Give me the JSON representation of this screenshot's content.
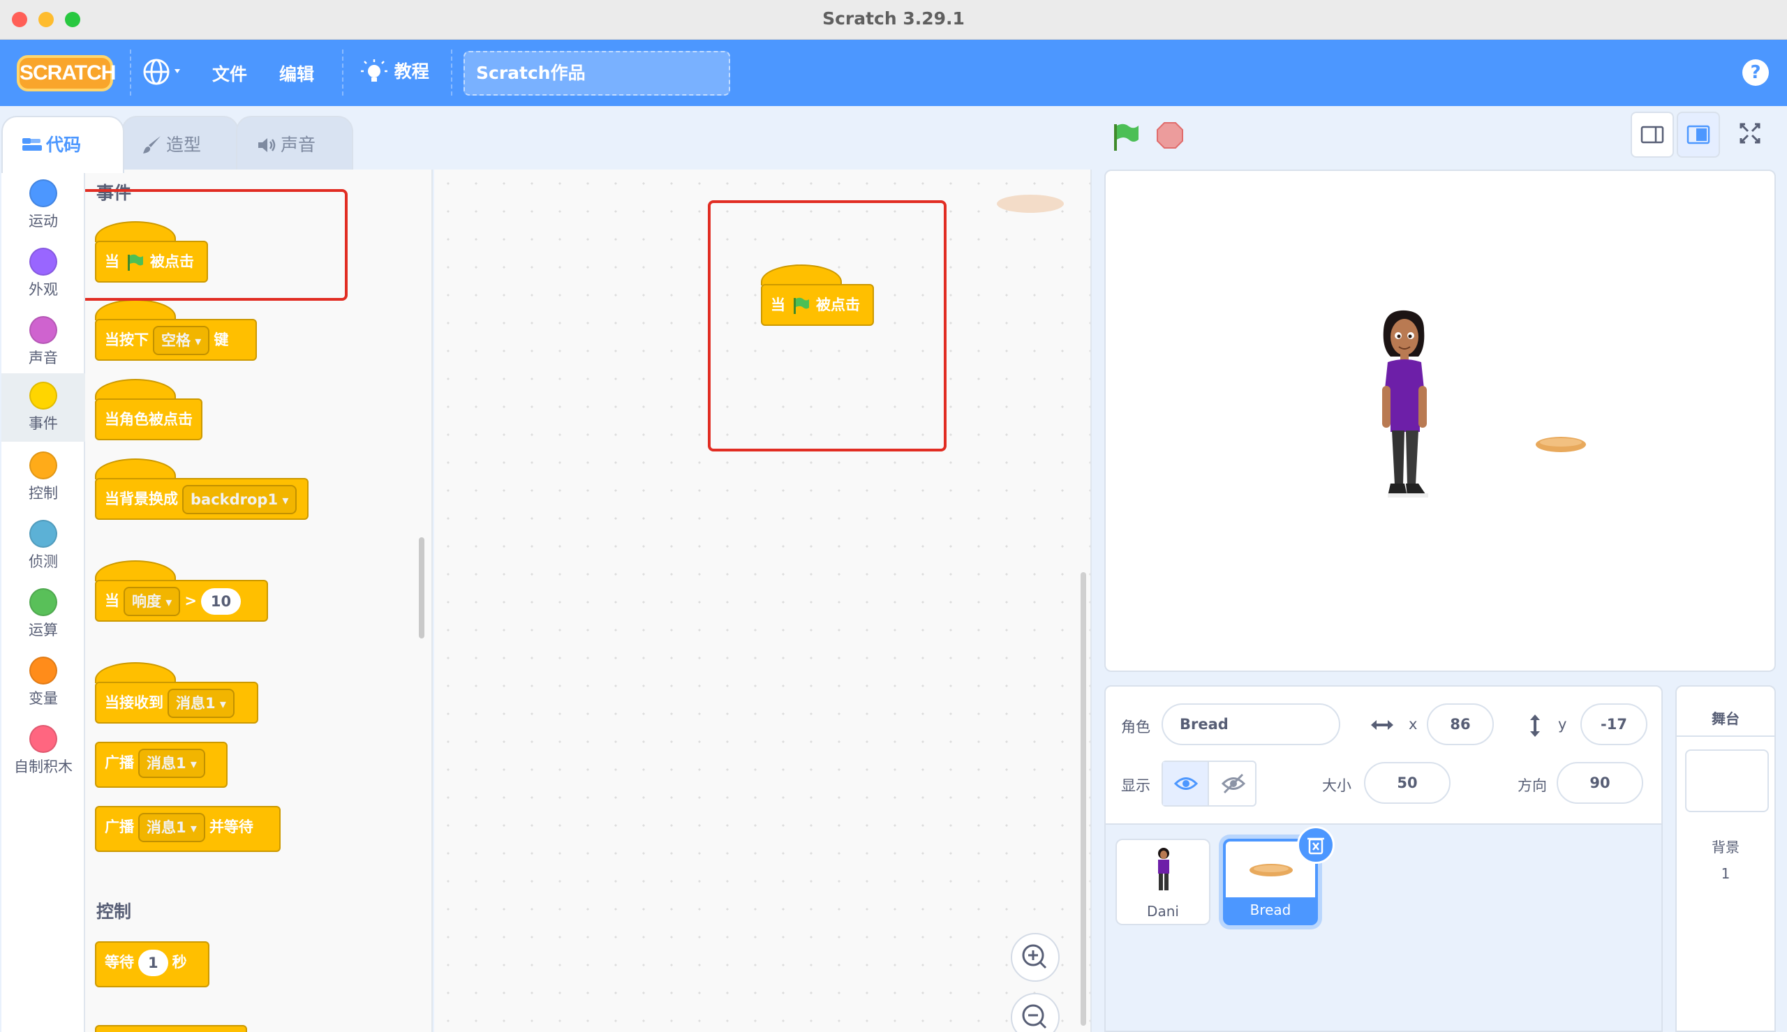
{
  "window": {
    "title": "Scratch 3.29.1"
  },
  "menu": {
    "logo": "SCRATCH",
    "file": "文件",
    "edit": "编辑",
    "tutorials": "教程",
    "project_title": "Scratch作品",
    "help": "?"
  },
  "tabs": {
    "code": "代码",
    "costumes": "造型",
    "sounds": "声音"
  },
  "categories": [
    {
      "label": "运动",
      "color": "#4c97ff"
    },
    {
      "label": "外观",
      "color": "#9966ff"
    },
    {
      "label": "声音",
      "color": "#cf63cf"
    },
    {
      "label": "事件",
      "color": "#ffd500"
    },
    {
      "label": "控制",
      "color": "#ffab19"
    },
    {
      "label": "侦测",
      "color": "#5cb1d6"
    },
    {
      "label": "运算",
      "color": "#59c059"
    },
    {
      "label": "变量",
      "color": "#ff8c1a"
    },
    {
      "label": "自制积木",
      "color": "#ff6680"
    }
  ],
  "palette": {
    "events_heading": "事件",
    "when_flag": {
      "pre": "当",
      "post": "被点击"
    },
    "when_key": {
      "pre": "当按下",
      "key": "空格",
      "post": "键"
    },
    "when_sprite_clicked": "当角色被点击",
    "when_backdrop": {
      "pre": "当背景换成",
      "value": "backdrop1"
    },
    "when_greater": {
      "pre": "当",
      "menu": "响度",
      "op": ">",
      "value": "10"
    },
    "when_receive": {
      "pre": "当接收到",
      "value": "消息1"
    },
    "broadcast": {
      "pre": "广播",
      "value": "消息1"
    },
    "broadcast_wait": {
      "pre": "广播",
      "value": "消息1",
      "post": "并等待"
    },
    "control_heading": "控制",
    "wait": {
      "pre": "等待",
      "value": "1",
      "post": "秒"
    }
  },
  "workspace": {
    "script": {
      "pre": "当",
      "post": "被点击"
    }
  },
  "sprite_info": {
    "sprite_label": "角色",
    "sprite_name": "Bread",
    "x_label": "x",
    "x": "86",
    "y_label": "y",
    "y": "-17",
    "show_label": "显示",
    "size_label": "大小",
    "size": "50",
    "direction_label": "方向",
    "direction": "90"
  },
  "sprites": [
    {
      "name": "Dani"
    },
    {
      "name": "Bread"
    }
  ],
  "stage_pane": {
    "title": "舞台",
    "backdrop_label": "背景",
    "backdrop_count": "1"
  },
  "colors": {
    "menu_blue": "#4c97ff",
    "event_yellow": "#ffbf00",
    "highlight_red": "#e12d23"
  }
}
